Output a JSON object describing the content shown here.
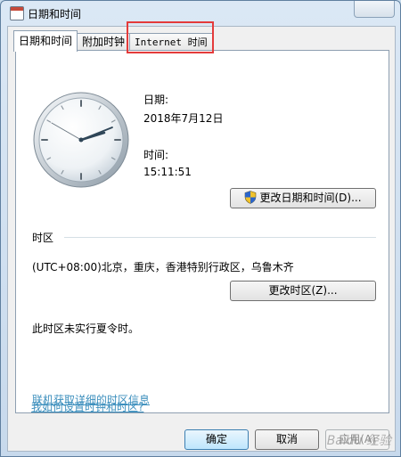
{
  "window": {
    "title": "日期和时间"
  },
  "tabs": [
    {
      "label": "日期和时间"
    },
    {
      "label": "附加时钟"
    },
    {
      "label": "Internet 时间"
    }
  ],
  "datetime": {
    "date_label": "日期:",
    "date_value": "2018年7月12日",
    "time_label": "时间:",
    "time_value": "15:11:51",
    "change_datetime_button": "更改日期和时间(D)..."
  },
  "timezone": {
    "section_label": "时区",
    "value": "(UTC+08:00)北京，重庆，香港特别行政区，乌鲁木齐",
    "change_timezone_button": "更改时区(Z)...",
    "dst_note": "此时区未实行夏令时。"
  },
  "links": {
    "online_timezone_info": "联机获取详细的时区信息",
    "how_to_set_clock": "我如何设置时钟和时区?"
  },
  "buttons": {
    "ok": "确定",
    "cancel": "取消",
    "apply": "应用(A)"
  },
  "watermark": "Baidu 经验",
  "colors": {
    "highlight": "#e43b3b",
    "link": "#3c8fbd"
  }
}
